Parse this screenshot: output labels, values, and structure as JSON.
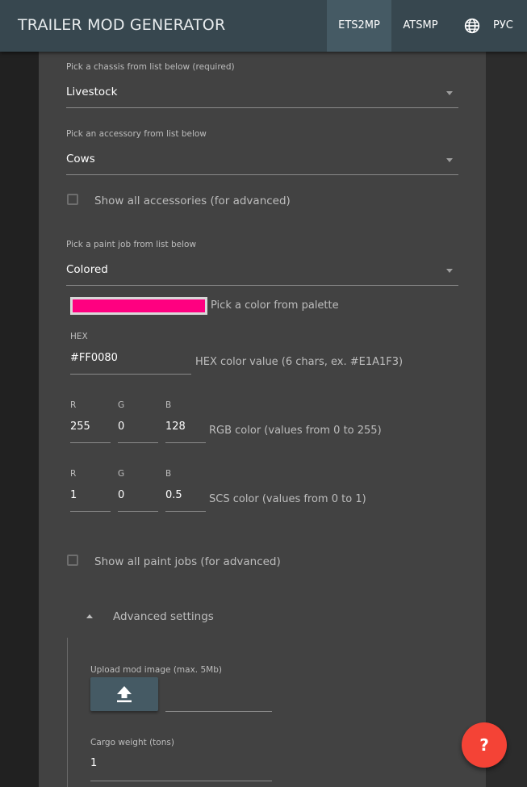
{
  "header": {
    "title": "TRAILER MOD GENERATOR",
    "nav": [
      {
        "label": "ETS2MP",
        "active": true
      },
      {
        "label": "ATSMP",
        "active": false
      }
    ],
    "language": {
      "icon": "globe-icon",
      "label": "РУС"
    }
  },
  "chassis": {
    "label": "Pick a chassis from list below (required)",
    "value": "Livestock"
  },
  "accessory": {
    "label": "Pick an accessory from list below",
    "value": "Cows"
  },
  "show_all_accessories": {
    "label": "Show all accessories (for advanced)",
    "checked": false
  },
  "paint_job": {
    "label": "Pick a paint job from list below",
    "value": "Colored"
  },
  "palette": {
    "color": "#FF0080",
    "hint": "Pick a color from palette"
  },
  "hex": {
    "label": "HEX",
    "value": "#FF0080",
    "hint": "HEX color value (6 chars, ex. #E1A1F3)"
  },
  "rgb": {
    "r_label": "R",
    "g_label": "G",
    "b_label": "B",
    "r": "255",
    "g": "0",
    "b": "128",
    "hint": "RGB color (values from 0 to 255)"
  },
  "scs": {
    "r_label": "R",
    "g_label": "G",
    "b_label": "B",
    "r": "1",
    "g": "0",
    "b": "0.5",
    "hint": "SCS color (values from 0 to 1)"
  },
  "show_all_paint_jobs": {
    "label": "Show all paint jobs (for advanced)",
    "checked": false
  },
  "advanced": {
    "label": "Advanced settings",
    "expanded": true,
    "upload_label": "Upload mod image (max. 5Mb)",
    "upload_icon": "upload-icon",
    "cargo_label": "Cargo weight (tons)",
    "cargo_value": "1"
  },
  "help": {
    "label": "?"
  },
  "colors": {
    "appbar": "#37474f",
    "accent": "#455a64",
    "fab": "#f44336",
    "panel": "#424242"
  }
}
